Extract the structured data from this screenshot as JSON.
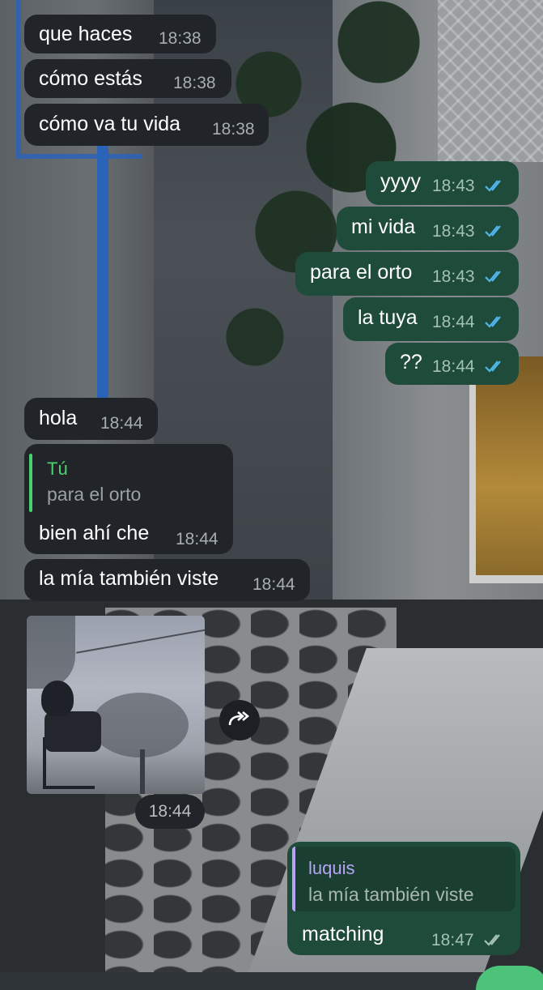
{
  "messages": [
    {
      "text": "que haces",
      "time": "18:38",
      "direction": "incoming"
    },
    {
      "text": "cómo estás",
      "time": "18:38",
      "direction": "incoming"
    },
    {
      "text": "cómo va tu vida",
      "time": "18:38",
      "direction": "incoming"
    },
    {
      "text": "yyyy",
      "time": "18:43",
      "direction": "outgoing",
      "status": "read"
    },
    {
      "text": "mi vida",
      "time": "18:43",
      "direction": "outgoing",
      "status": "read"
    },
    {
      "text": "para el orto",
      "time": "18:43",
      "direction": "outgoing",
      "status": "read"
    },
    {
      "text": "la tuya",
      "time": "18:44",
      "direction": "outgoing",
      "status": "read"
    },
    {
      "text": "??",
      "time": "18:44",
      "direction": "outgoing",
      "status": "read"
    },
    {
      "text": "hola",
      "time": "18:44",
      "direction": "incoming"
    },
    {
      "text": "bien ahí che",
      "time": "18:44",
      "direction": "incoming",
      "reply": {
        "name": "Tú",
        "text": "para el orto"
      }
    },
    {
      "text": "la mía también viste",
      "time": "18:44",
      "direction": "incoming"
    },
    {
      "type": "image",
      "time": "18:44",
      "direction": "incoming",
      "image": "foggy-person-in-chair-photo"
    },
    {
      "text": "matching",
      "time": "18:47",
      "direction": "outgoing",
      "status": "delivered",
      "reply": {
        "name": "luquis",
        "text": "la mía también viste"
      }
    }
  ],
  "icons": {
    "forward": "forward-icon",
    "read": "double-check-icon",
    "delivered": "double-check-icon"
  },
  "colors": {
    "incoming_bubble": "#212529",
    "outgoing_bubble": "#1f4b3a",
    "read_ticks": "#4fb6ec",
    "delivered_ticks": "#a3c2b4",
    "reply_you": "#4ad26f",
    "reply_other": "#b7a4f5"
  }
}
